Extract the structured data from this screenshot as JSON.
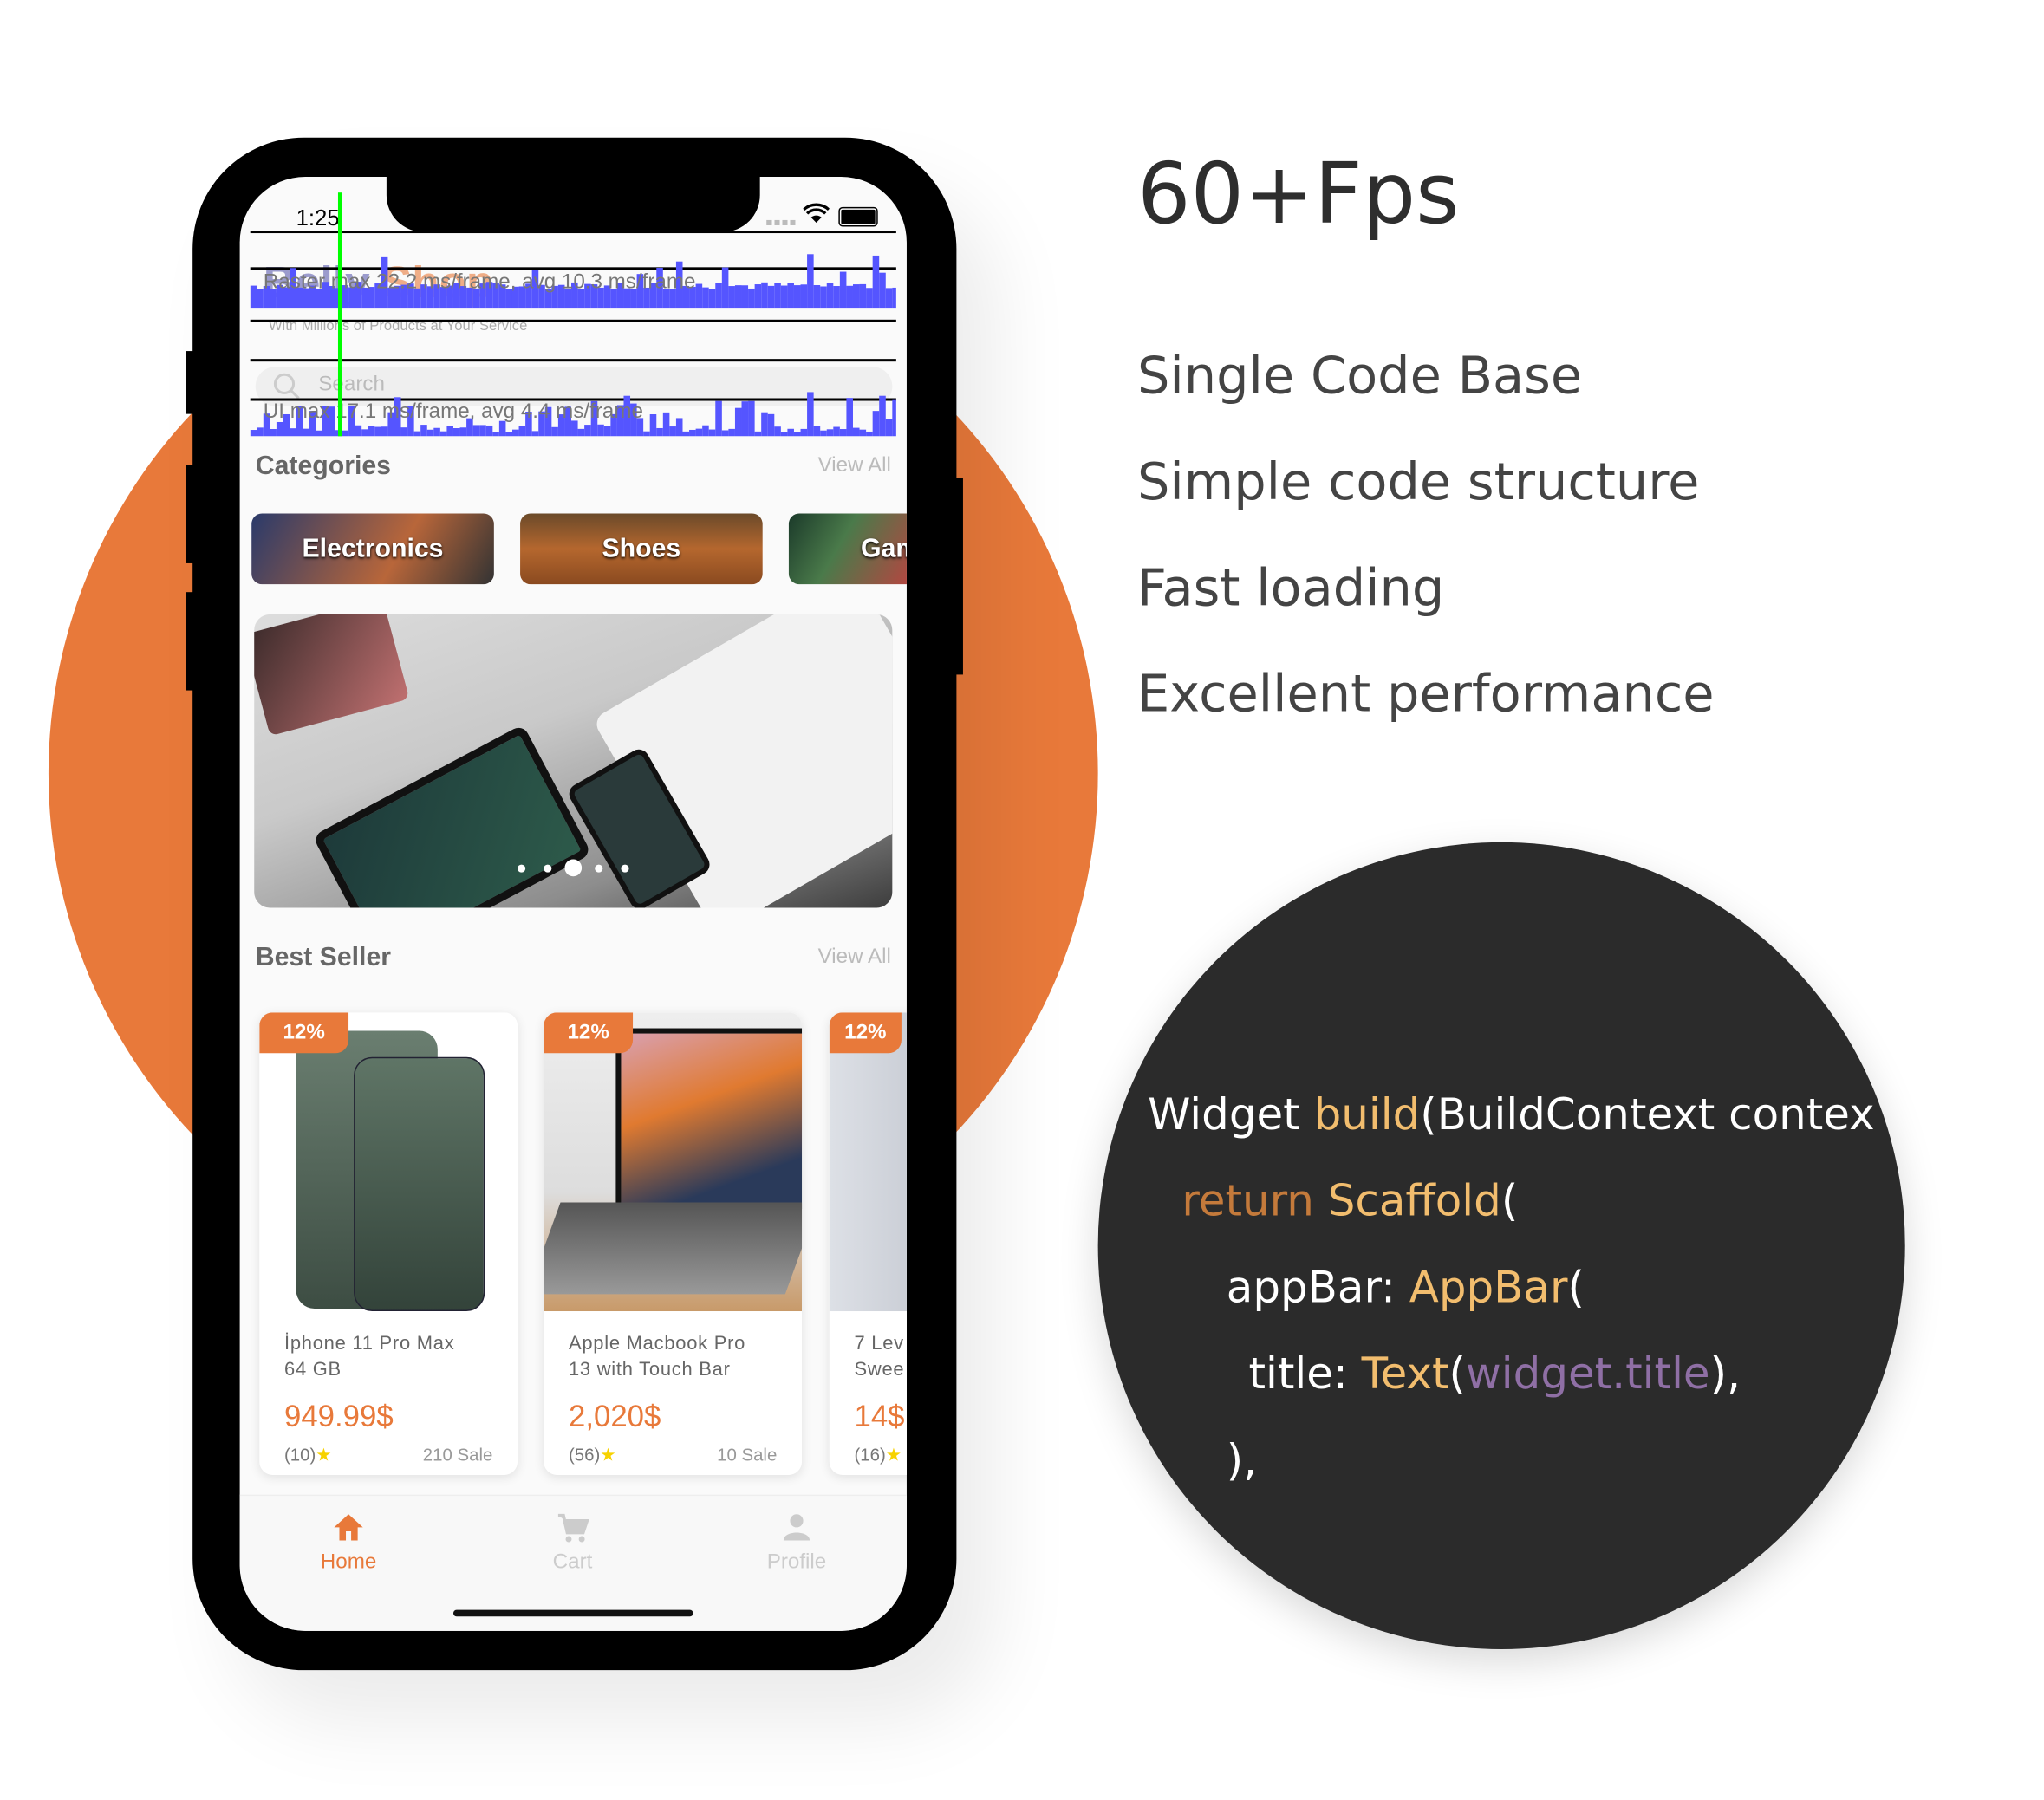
{
  "marketing": {
    "headline": "60+Fps",
    "features": [
      "Single Code Base",
      "Simple code structure",
      "Fast loading",
      "Excellent performance"
    ]
  },
  "code_snippet": {
    "line1": {
      "a": "Widget ",
      "b": "build",
      "c": "(BuildContext contex"
    },
    "line2": {
      "a": "return ",
      "b": "Scaffold",
      "c": "("
    },
    "line3": {
      "a": "appBar: ",
      "b": "AppBar",
      "c": "("
    },
    "line4": {
      "a": "title: ",
      "b": "Text",
      "c": "(",
      "d": "widget.title",
      "e": "),"
    },
    "line5": "),"
  },
  "colors": {
    "accent": "#e8793a",
    "code_bg": "#2b2b2b",
    "code_yellow": "#f2bd6e",
    "code_purple": "#8f6fa5",
    "perf_bar": "#5555ff",
    "perf_marker": "#00ff00"
  },
  "status_bar": {
    "time": "1:25",
    "icons": [
      "signal-icon",
      "wifi-icon",
      "battery-icon"
    ]
  },
  "perf_overlay": {
    "raster": "Raster  max 22.2 ms/frame, avg 10.3 ms/frame",
    "ui": "UI  max 17.1 ms/frame, avg 4.4 ms/frame"
  },
  "app": {
    "title_a": "Belly ",
    "title_b": "Shop",
    "subtitle": "With Millions of Products at Your Service",
    "search_placeholder": "Search",
    "categories_title": "Categories",
    "best_seller_title": "Best Seller",
    "view_all": "View All",
    "categories": [
      "Electronics",
      "Shoes",
      "Games"
    ],
    "products": [
      {
        "badge": "12%",
        "name1": "İphone 11 Pro Max",
        "name2": "64 GB",
        "price": "949.99$",
        "rating": "(10)",
        "sale": "210 Sale"
      },
      {
        "badge": "12%",
        "name1": "Apple Macbook Pro",
        "name2": "13 with Touch Bar",
        "price": "2,020$",
        "rating": "(56)",
        "sale": "10 Sale"
      },
      {
        "badge": "12%",
        "name1": "7 Lev",
        "name2": "Swee",
        "price": "14$",
        "rating": "(16)",
        "sale": ""
      }
    ],
    "nav": [
      {
        "label": "Home",
        "icon": "home-icon",
        "active": true
      },
      {
        "label": "Cart",
        "icon": "cart-icon",
        "active": false
      },
      {
        "label": "Profile",
        "icon": "profile-icon",
        "active": false
      }
    ],
    "banner_page": 3,
    "banner_pages": 5
  }
}
